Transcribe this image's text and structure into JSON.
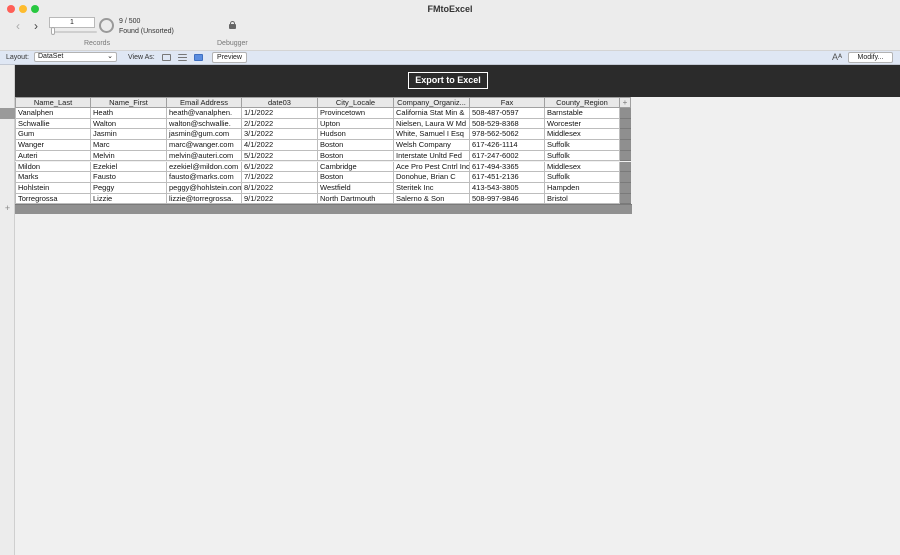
{
  "window": {
    "title": "FMtoExcel"
  },
  "toolbar": {
    "back_icon": "chevron-left-icon",
    "forward_icon": "chevron-right-icon",
    "record_value": "1",
    "record_count": "9 / 500",
    "found_status": "Found (Unsorted)",
    "records_label": "Records",
    "debugger_label": "Debugger"
  },
  "layout_bar": {
    "layout_label": "Layout:",
    "layout_value": "DataSet",
    "view_as_label": "View As:",
    "preview_label": "Preview",
    "font_icon_glyph": "Aᴬ",
    "modify_label": "Modify..."
  },
  "header": {
    "export_label": "Export to Excel",
    "band_color": "#2b2b2b"
  },
  "table": {
    "columns": [
      "Name_Last",
      "Name_First",
      "Email Address",
      "date03",
      "City_Locale",
      "Company_Organiz...",
      "Fax",
      "County_Region"
    ],
    "rows": [
      [
        "Vanalphen",
        "Heath",
        "heath@vanalphen.",
        "1/1/2022",
        "Provincetown",
        "California Stat Min &",
        "508-487-0597",
        "Barnstable"
      ],
      [
        "Schwallie",
        "Walton",
        "walton@schwallie.",
        "2/1/2022",
        "Upton",
        "Nielsen, Laura W Md",
        "508-529-8368",
        "Worcester"
      ],
      [
        "Gum",
        "Jasmin",
        "jasmin@gum.com",
        "3/1/2022",
        "Hudson",
        "White, Samuel I Esq",
        "978-562-5062",
        "Middlesex"
      ],
      [
        "Wanger",
        "Marc",
        "marc@wanger.com",
        "4/1/2022",
        "Boston",
        "Welsh Company",
        "617-426-1114",
        "Suffolk"
      ],
      [
        "Auteri",
        "Melvin",
        "melvin@auteri.com",
        "5/1/2022",
        "Boston",
        "Interstate Unltd Fed",
        "617-247-6002",
        "Suffolk"
      ],
      [
        "Mildon",
        "Ezekiel",
        "ezekiel@mildon.com",
        "6/1/2022",
        "Cambridge",
        "Ace Pro Pest Cntrl Inc",
        "617-494-3365",
        "Middlesex"
      ],
      [
        "Marks",
        "Fausto",
        "fausto@marks.com",
        "7/1/2022",
        "Boston",
        "Donohue, Brian C",
        "617-451-2136",
        "Suffolk"
      ],
      [
        "Hohlstein",
        "Peggy",
        "peggy@hohlstein.com",
        "8/1/2022",
        "Westfield",
        "Steritek Inc",
        "413-543-3805",
        "Hampden"
      ],
      [
        "Torregrossa",
        "Lizzie",
        "lizzie@torregrossa.",
        "9/1/2022",
        "North Dartmouth",
        "Salerno & Son",
        "508-997-9846",
        "Bristol"
      ]
    ]
  }
}
